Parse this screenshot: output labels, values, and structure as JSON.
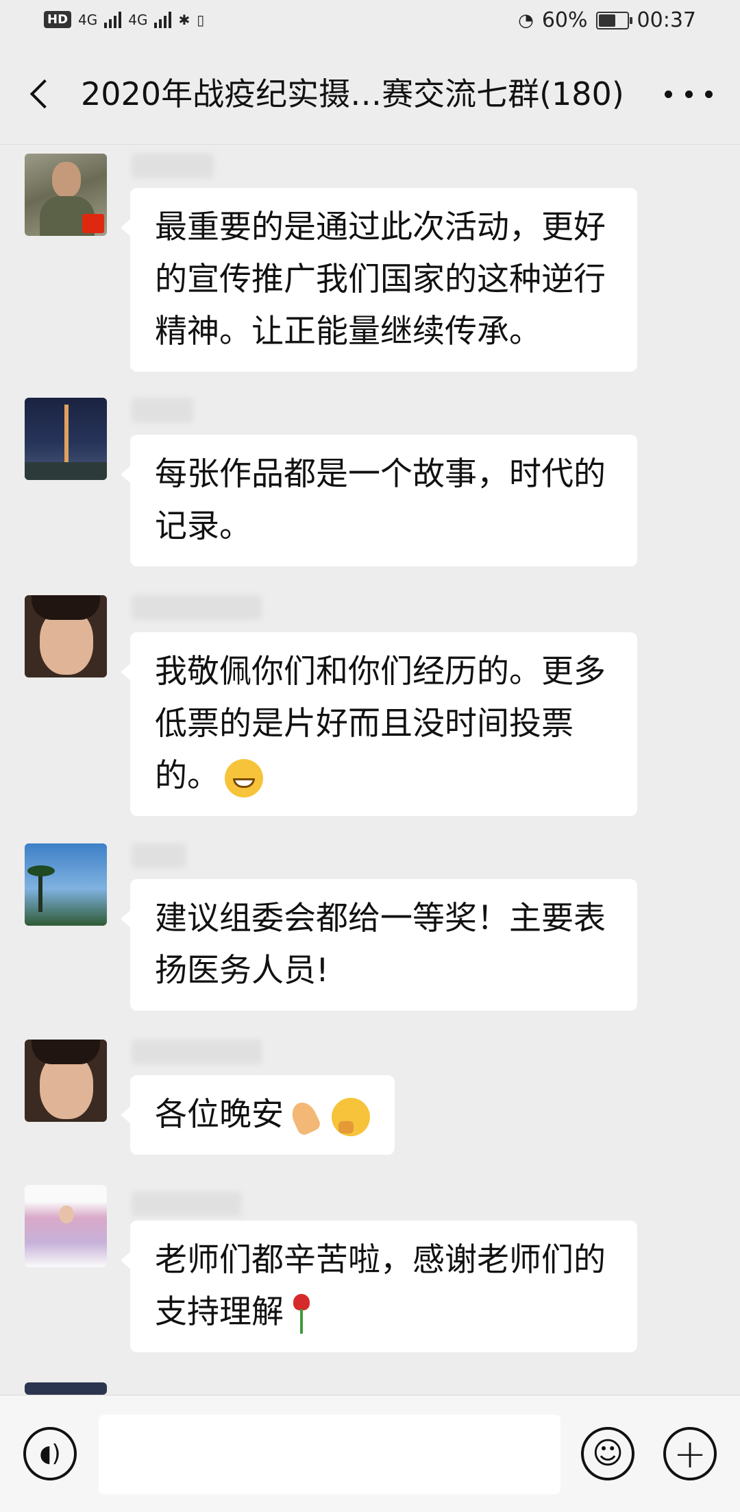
{
  "status_bar": {
    "hd": "HD",
    "signal1": "4G",
    "signal2": "4G",
    "battery_percent": "60%",
    "battery_level": 0.6,
    "time": "00:37"
  },
  "nav": {
    "title": "2020年战疫纪实摄…赛交流七群(180)"
  },
  "messages": [
    {
      "text": "最重要的是通过此次活动，更好的宣传推广我们国家的这种逆行精神。让正能量继续传承。"
    },
    {
      "text": "每张作品都是一个故事，时代的记录。"
    },
    {
      "text": "我敬佩你们和你们经历的。更多低票的是片好而且没时间投票的。",
      "emoji": "grinning-face-emoji"
    },
    {
      "text": "建议组委会都给一等奖！主要表扬医务人员!"
    },
    {
      "text": "各位晚安",
      "emoji": "pinched-fingers-emoji"
    },
    {
      "text": "老师们都辛苦啦，感谢老师们的支持理解",
      "emoji": "rose-emoji"
    }
  ],
  "colors": {
    "background": "#ededed",
    "bubble": "#ffffff"
  }
}
